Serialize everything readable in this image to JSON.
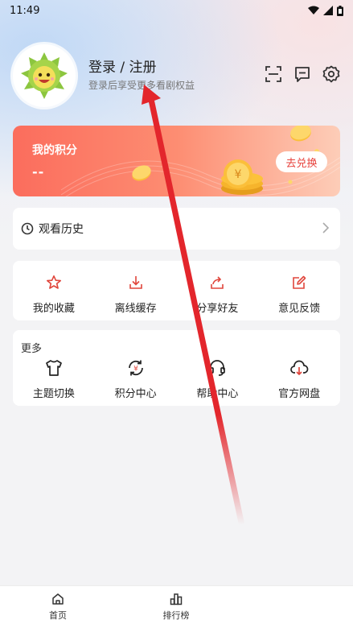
{
  "status_bar": {
    "time": "11:49"
  },
  "profile": {
    "title": "登录 / 注册",
    "subtitle": "登录后享受更多看剧权益"
  },
  "icons": {
    "scan": "scan-icon",
    "message": "message-icon",
    "settings": "gear-icon"
  },
  "points": {
    "title": "我的积分",
    "value": "--",
    "redeem_label": "去兑换"
  },
  "history": {
    "label": "观看历史"
  },
  "actions": [
    {
      "label": "我的收藏",
      "icon": "star-icon"
    },
    {
      "label": "离线缓存",
      "icon": "download-icon"
    },
    {
      "label": "分享好友",
      "icon": "share-icon"
    },
    {
      "label": "意见反馈",
      "icon": "edit-icon"
    }
  ],
  "more": {
    "title": "更多",
    "items": [
      {
        "label": "主题切换",
        "icon": "tshirt-icon"
      },
      {
        "label": "积分中心",
        "icon": "points-exchange-icon"
      },
      {
        "label": "帮助中心",
        "icon": "headset-icon"
      },
      {
        "label": "官方网盘",
        "icon": "cloud-download-icon"
      }
    ]
  },
  "tabbar": [
    {
      "label": "首页",
      "icon": "home-icon"
    },
    {
      "label": "排行榜",
      "icon": "ranking-icon"
    }
  ],
  "colors": {
    "accent": "#e7413b",
    "card_gradient_start": "#fb6d5d",
    "card_gradient_end": "#fdcdb8"
  }
}
